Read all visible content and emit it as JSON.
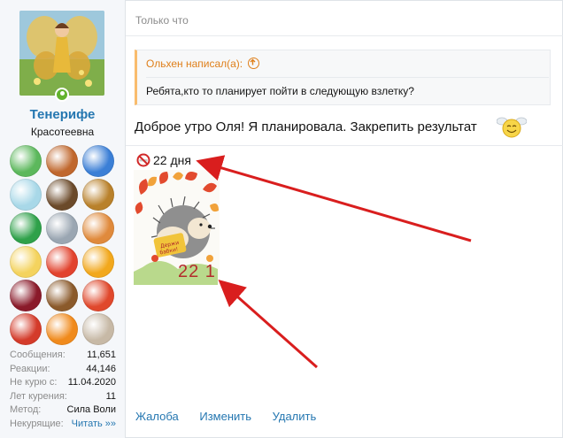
{
  "user": {
    "name": "Тенерифе",
    "title": "Красотеевна",
    "avatar_icon": "fairy-avatar-icon",
    "online_icon": "online-status-icon"
  },
  "awards": [
    {
      "icon": "apple-award-icon",
      "color": "#5cb85c"
    },
    {
      "icon": "horse-award-icon",
      "color": "#c0672d"
    },
    {
      "icon": "blue-bird-award-icon",
      "color": "#3b7fd6"
    },
    {
      "icon": "badge-award-icon",
      "color": "#a8d8e8"
    },
    {
      "icon": "wheel-award-icon",
      "color": "#6b4a2a"
    },
    {
      "icon": "runner-award-icon",
      "color": "#b9812b"
    },
    {
      "icon": "ambulance-award-icon",
      "color": "#2fa14a"
    },
    {
      "icon": "magnifier-award-icon",
      "color": "#9aa6b2"
    },
    {
      "icon": "camera-award-icon",
      "color": "#e08a3c"
    },
    {
      "icon": "daisy-award-icon",
      "color": "#f4d35e"
    },
    {
      "icon": "apple-2-award-icon",
      "color": "#e2432e"
    },
    {
      "icon": "sun-award-icon",
      "color": "#f2a81d"
    },
    {
      "icon": "heart-award-icon",
      "color": "#8a1a2a"
    },
    {
      "icon": "chevron-award-icon",
      "color": "#8b5a2b"
    },
    {
      "icon": "flower-award-icon",
      "color": "#e0482c"
    },
    {
      "icon": "tomato-2-award-icon",
      "color": "#d43b2a"
    },
    {
      "icon": "butterfly-award-icon",
      "color": "#f08a1c"
    },
    {
      "icon": "bottle-award-icon",
      "color": "#c7b9a6"
    }
  ],
  "stats": [
    {
      "label": "Сообщения:",
      "value": "11,651"
    },
    {
      "label": "Реакции:",
      "value": "44,146"
    },
    {
      "label": "Не курю с:",
      "value": "11.04.2020"
    },
    {
      "label": "Лет курения:",
      "value": "11"
    },
    {
      "label": "Метод:",
      "value": "Сила Воли"
    },
    {
      "label": "Некурящие:",
      "value": "Читать »»"
    }
  ],
  "post": {
    "time": "Только что",
    "quote_author": "Ольхен написал(а):",
    "quote_text": "Ребята,кто то планирует пойти в следующую взлетку?",
    "message": "Доброе утро Оля! Я планировала. Закрепить результат",
    "signature_days": "22 дня",
    "signature_caption": "22 1",
    "image_icon": "hedgehog-image-icon"
  },
  "actions": {
    "report": "Жалоба",
    "edit": "Изменить",
    "delete": "Удалить"
  },
  "colors": {
    "link": "#2577b1",
    "quote_accent": "#f9bc6d",
    "quote_author": "#df7f1a",
    "annotation_arrow": "#d91e1e"
  }
}
